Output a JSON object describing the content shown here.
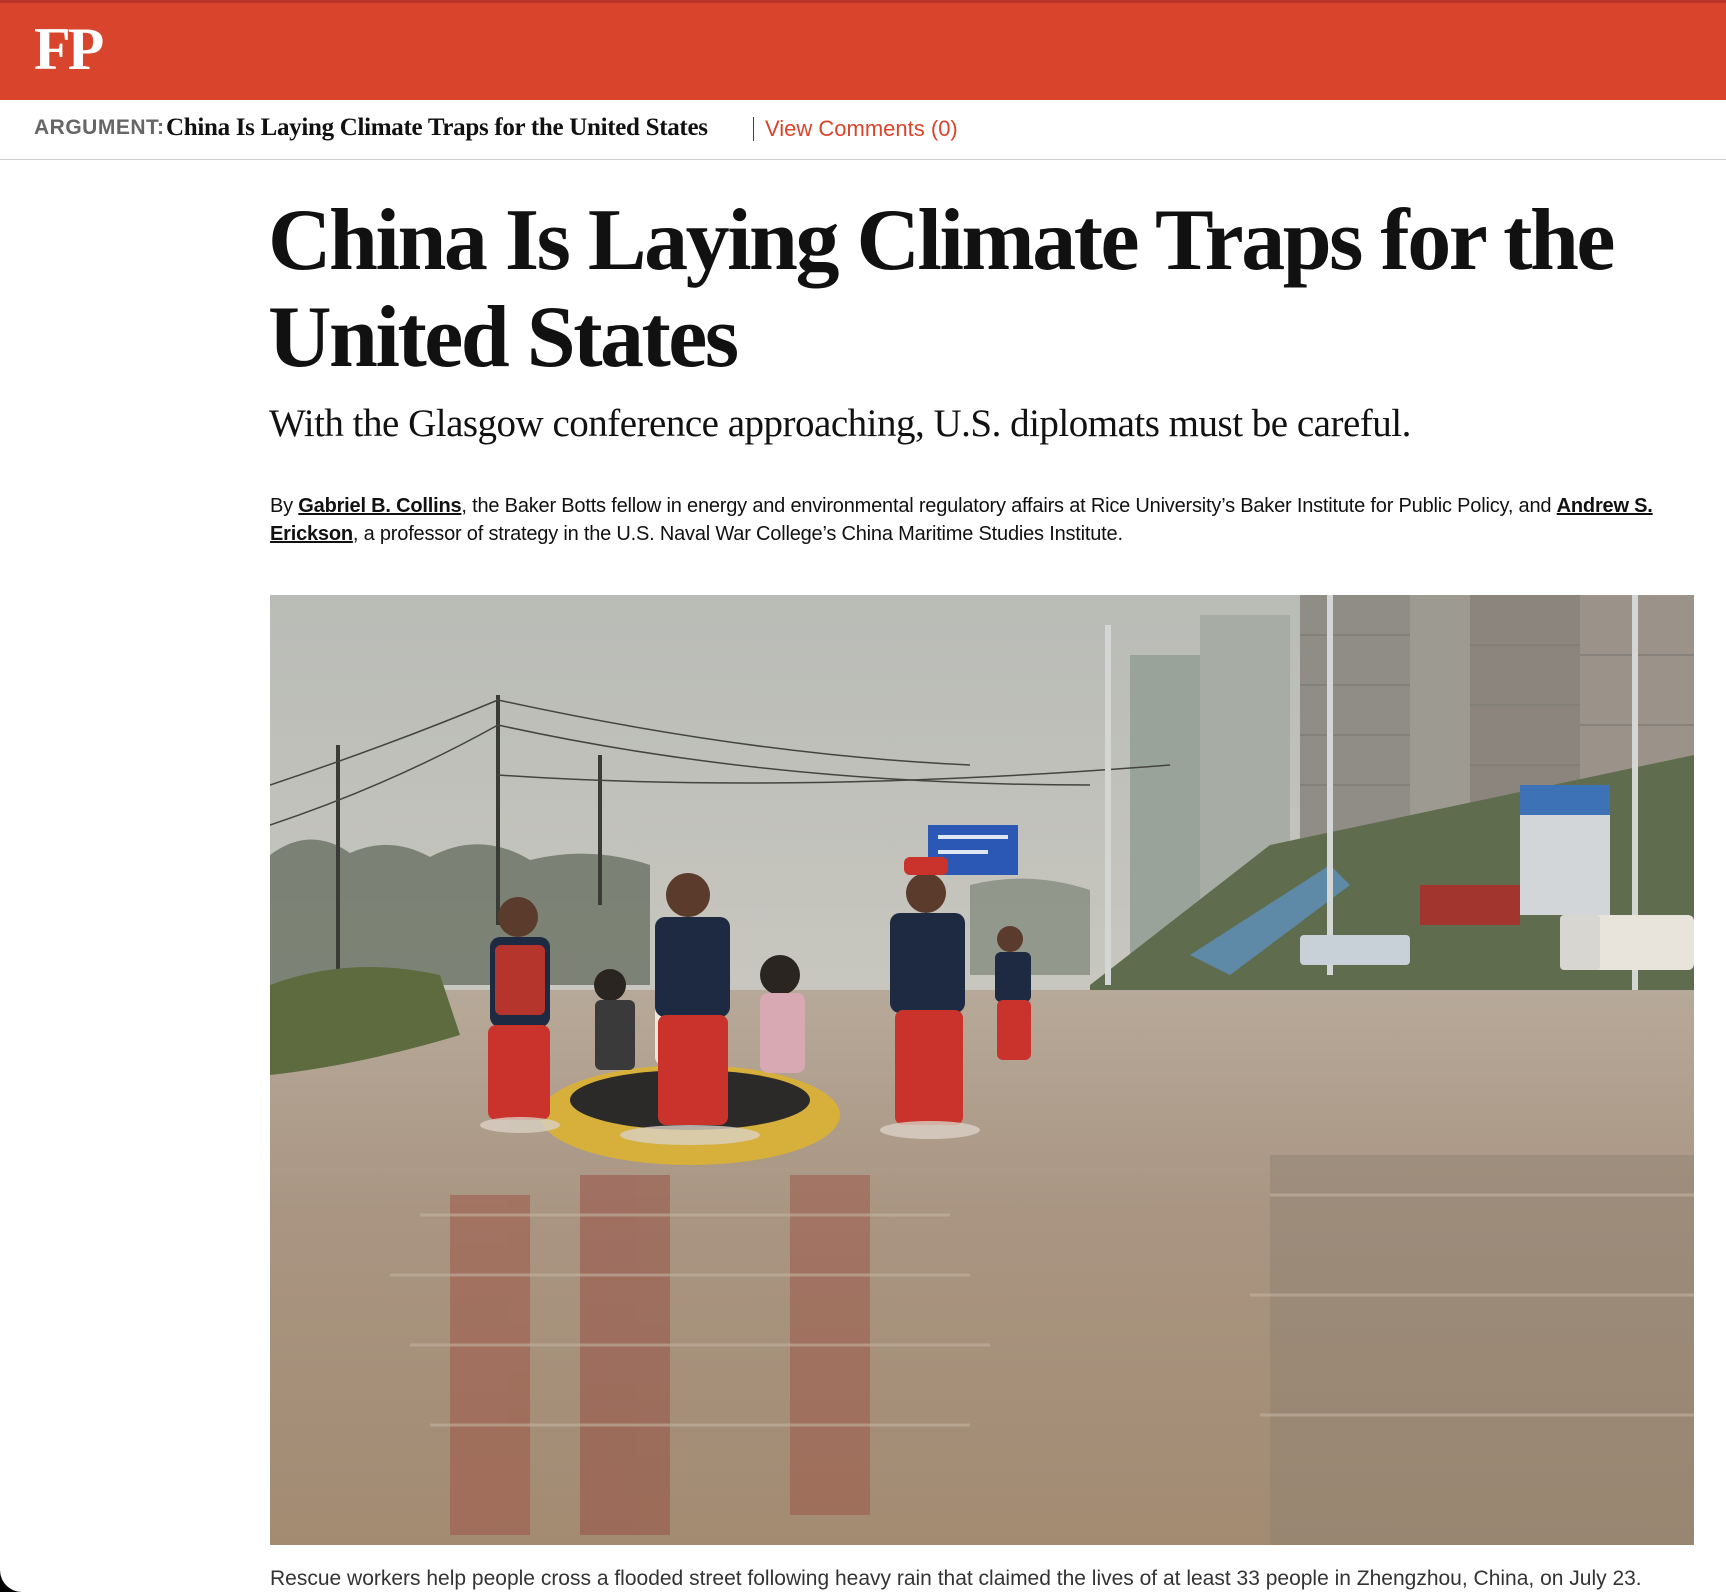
{
  "brand": {
    "logo": "FP",
    "bar_color": "#d9442c"
  },
  "subbar": {
    "kicker": "ARGUMENT:",
    "title": "China Is Laying Climate Traps for the United States",
    "comments_link": "View Comments (0)"
  },
  "article": {
    "headline": "China Is Laying Climate Traps for the United States",
    "dek": "With the Glasgow conference approaching, U.S. diplomats must be careful.",
    "byline": {
      "prefix": "By ",
      "author1": "Gabriel B. Collins",
      "author1_desc": ", the Baker Botts fellow in energy and environmental regulatory affairs at Rice University’s Baker Institute for Public Policy, and ",
      "author2": "Andrew S. Erickson",
      "author2_desc": ", a professor of strategy in the U.S. Naval War College’s China Maritime Studies Institute."
    },
    "image": {
      "sign_color": "#2a58b4",
      "accent_red": "#c9332b"
    },
    "caption": "Rescue workers help people cross a flooded street following heavy rain that claimed the lives of at least 33 people in Zhengzhou, China, on July 23."
  }
}
